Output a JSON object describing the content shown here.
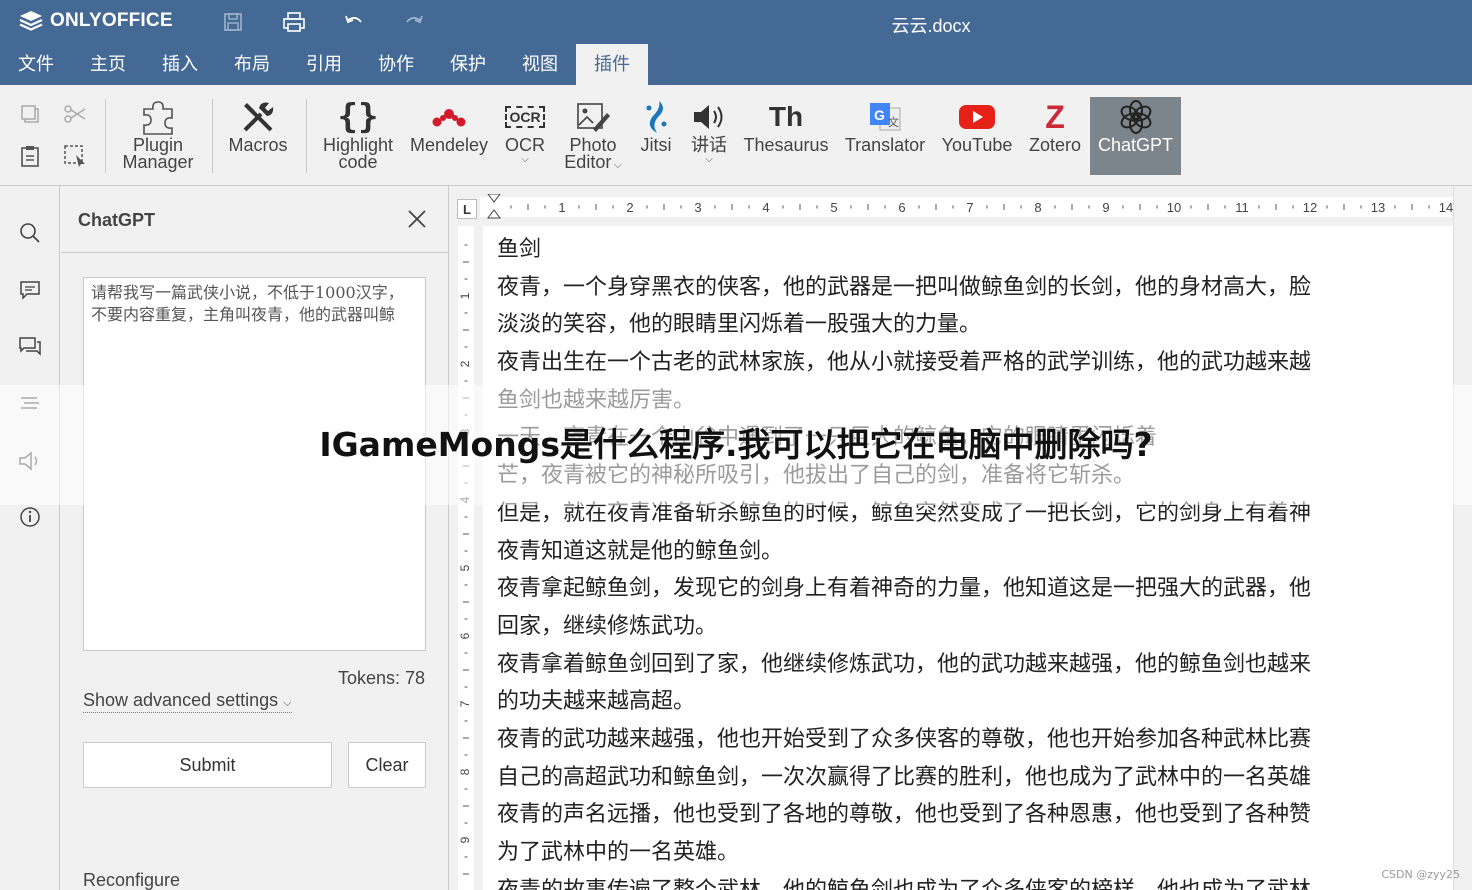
{
  "app": {
    "name": "ONLYOFFICE",
    "doc_title": "云云.docx"
  },
  "menu": [
    "文件",
    "主页",
    "插入",
    "布局",
    "引用",
    "协作",
    "保护",
    "视图",
    "插件"
  ],
  "active_menu": "插件",
  "toolbar": {
    "plugin_manager": [
      "Plugin",
      "Manager"
    ],
    "macros": "Macros",
    "highlight_code": [
      "Highlight",
      "code"
    ],
    "mendeley": "Mendeley",
    "ocr": "OCR",
    "photo_editor": [
      "Photo",
      "Editor"
    ],
    "jitsi": "Jitsi",
    "speech": "讲话",
    "thesaurus": "Thesaurus",
    "translator": "Translator",
    "youtube": "YouTube",
    "zotero": "Zotero",
    "chatgpt": "ChatGPT",
    "thesaurus_icon_text": "Th",
    "ocr_icon_text": "OCR",
    "zotero_icon_text": "Z"
  },
  "panel": {
    "title": "ChatGPT",
    "prompt": "请帮我写一篇武侠小说，不低于1000汉字，不要内容重复，主角叫夜青，他的武器叫鲸",
    "tokens": "Tokens: 78",
    "advanced": "Show advanced settings",
    "submit": "Submit",
    "clear": "Clear",
    "reconfigure": "Reconfigure"
  },
  "ruler": {
    "corner": "L",
    "h_labels": [
      "1",
      "2",
      "3",
      "4",
      "5",
      "6",
      "7",
      "8",
      "9",
      "10",
      "11",
      "12",
      "13",
      "14"
    ],
    "v_labels": [
      "1",
      "2",
      "3",
      "4",
      "5",
      "6",
      "7",
      "8",
      "9"
    ]
  },
  "document": {
    "lines": [
      "鱼剑",
      "夜青，一个身穿黑衣的侠客，他的武器是一把叫做鲸鱼剑的长剑，他的身材高大，脸",
      "淡淡的笑容，他的眼睛里闪烁着一股强大的力量。",
      "夜青出生在一个古老的武林家族，他从小就接受着严格的武学训练，他的武功越来越",
      "鱼剑也越来越厉害。",
      "一天，夜青在一个山谷中遇到了一只巨大的鲸鱼，它的眼睛里闪烁着",
      "芒，夜青被它的神秘所吸引，他拔出了自己的剑，准备将它斩杀。",
      "但是，就在夜青准备斩杀鲸鱼的时候，鲸鱼突然变成了一把长剑，它的剑身上有着神",
      "夜青知道这就是他的鲸鱼剑。",
      "夜青拿起鲸鱼剑，发现它的剑身上有着神奇的力量，他知道这是一把强大的武器，他",
      "回家，继续修炼武功。",
      "夜青拿着鲸鱼剑回到了家，他继续修炼武功，他的武功越来越强，他的鲸鱼剑也越来",
      "的功夫越来越高超。",
      "夜青的武功越来越强，他也开始受到了众多侠客的尊敬，他也开始参加各种武林比赛",
      "自己的高超武功和鲸鱼剑，一次次赢得了比赛的胜利，他也成为了武林中的一名英雄",
      "夜青的声名远播，他也受到了各地的尊敬，他也受到了各种恩惠，他也受到了各种赞",
      "为了武林中的一名英雄。",
      "夜青的故事传遍了整个武林，他的鲸鱼剑也成为了众多侠客的榜样，他也成为了武林"
    ]
  },
  "overlay": {
    "headline": "IGameMongs是什么程序.我可以把它在电脑中删除吗?"
  },
  "watermark": "CSDN @zyy25",
  "colors": {
    "title_bar": "#446995",
    "youtube_red": "#e62117",
    "zotero_red": "#cc2936",
    "mendeley_red": "#d11a2a",
    "jitsi_blue": "#1d76ba",
    "chatgpt_active": "#7d858c"
  }
}
